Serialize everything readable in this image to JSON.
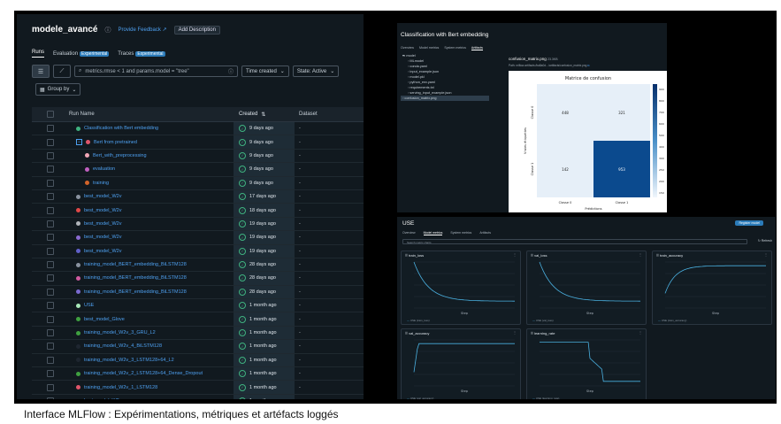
{
  "runs_page": {
    "experiment_title": "modele_avancé",
    "feedback_link": "Provide Feedback",
    "add_description": "Add Description",
    "tabs": [
      {
        "label": "Runs",
        "badge": ""
      },
      {
        "label": "Evaluation",
        "badge": "Experimental"
      },
      {
        "label": "Traces",
        "badge": "Experimental"
      }
    ],
    "search_value": "metrics.rmse < 1 and params.model = \"tree\"",
    "sort_dropdown": "Time created",
    "state_dropdown": "State: Active",
    "group_by": "Group by",
    "columns": {
      "name": "Run Name",
      "created": "Created",
      "dataset": "Dataset"
    },
    "rows": [
      {
        "name": "Classification with Bert embedding",
        "created": "9 days ago",
        "dataset": "-",
        "color": "#3fb27f",
        "level": 0,
        "parent": false
      },
      {
        "name": "Bert from pretrained",
        "created": "9 days ago",
        "dataset": "-",
        "color": "#e0566b",
        "level": 0,
        "parent": true
      },
      {
        "name": "Bert_with_preprocessing",
        "created": "9 days ago",
        "dataset": "-",
        "color": "#f0a6b6",
        "level": 1,
        "parent": false
      },
      {
        "name": "evaluation",
        "created": "9 days ago",
        "dataset": "-",
        "color": "#c060c0",
        "level": 1,
        "parent": false
      },
      {
        "name": "training",
        "created": "9 days ago",
        "dataset": "-",
        "color": "#d2642a",
        "level": 1,
        "parent": false
      },
      {
        "name": "best_model_W2v",
        "created": "17 days ago",
        "dataset": "-",
        "color": "#8a93a0",
        "level": 0,
        "parent": false
      },
      {
        "name": "best_model_W2v",
        "created": "18 days ago",
        "dataset": "-",
        "color": "#e04848",
        "level": 0,
        "parent": false
      },
      {
        "name": "best_model_W2v",
        "created": "19 days ago",
        "dataset": "-",
        "color": "#b0b4ba",
        "level": 0,
        "parent": false
      },
      {
        "name": "best_model_W2v",
        "created": "19 days ago",
        "dataset": "-",
        "color": "#8a6ad0",
        "level": 0,
        "parent": false
      },
      {
        "name": "best_model_W2v",
        "created": "19 days ago",
        "dataset": "-",
        "color": "#6060c8",
        "level": 0,
        "parent": false
      },
      {
        "name": "training_model_BERT_embedding_BiLSTM128",
        "created": "28 days ago",
        "dataset": "-",
        "color": "#8a93a0",
        "level": 0,
        "parent": false
      },
      {
        "name": "training_model_BERT_embedding_BiLSTM128",
        "created": "28 days ago",
        "dataset": "-",
        "color": "#d05aa0",
        "level": 0,
        "parent": false
      },
      {
        "name": "training_model_BERT_embedding_BiLSTM128",
        "created": "28 days ago",
        "dataset": "-",
        "color": "#7a6ad0",
        "level": 0,
        "parent": false
      },
      {
        "name": "USE",
        "created": "1 month ago",
        "dataset": "-",
        "color": "#a8e8b8",
        "level": 0,
        "parent": false
      },
      {
        "name": "best_model_Glove",
        "created": "1 month ago",
        "dataset": "-",
        "color": "#3fa040",
        "level": 0,
        "parent": false
      },
      {
        "name": "training_model_W2v_3_GRU_L2",
        "created": "1 month ago",
        "dataset": "-",
        "color": "#3fa040",
        "level": 0,
        "parent": false
      },
      {
        "name": "training_model_W2v_4_BiLSTM128",
        "created": "1 month ago",
        "dataset": "-",
        "color": "#1e2630",
        "level": 0,
        "parent": false
      },
      {
        "name": "training_model_W2v_3_LSTM128+64_L2",
        "created": "1 month ago",
        "dataset": "-",
        "color": "#1e2630",
        "level": 0,
        "parent": false
      },
      {
        "name": "training_model_W2v_2_LSTM128+64_Dense_Dropout",
        "created": "1 month ago",
        "dataset": "-",
        "color": "#3fa040",
        "level": 0,
        "parent": false
      },
      {
        "name": "training_model_W2v_1_LSTM128",
        "created": "1 month ago",
        "dataset": "-",
        "color": "#e0566b",
        "level": 0,
        "parent": false
      },
      {
        "name": "best_model_W2v",
        "created": "1 month ago",
        "dataset": "-",
        "color": "#3fa040",
        "level": 0,
        "parent": false
      }
    ]
  },
  "artifacts_page": {
    "run_title": "Classification with Bert embedding",
    "tabs": [
      "Overview",
      "Model metrics",
      "System metrics",
      "Artifacts"
    ],
    "active_tab": "Artifacts",
    "tree": [
      "model",
      "MLmodel",
      "conda.yaml",
      "input_example.json",
      "model.pkl",
      "python_env.yaml",
      "requirements.txt",
      "serving_input_example.json",
      "confusion_matrix.png"
    ],
    "selected_file": "confusion_matrix.png",
    "file_name": "confusion_matrix.png",
    "file_size": "23.3KB",
    "file_path": "Path: mlflow-artifacts:/ba8a0d…/artifacts/confusion_matrix.png",
    "confusion_matrix": {
      "title": "Matrice de confusion",
      "xlabel": "Prédictions",
      "ylabel": "Vraies étiquettes",
      "x_ticks": [
        "Classe 0",
        "Classe 1"
      ],
      "y_ticks": [
        "Classe 0",
        "Classe 1"
      ],
      "cells": [
        [
          448,
          321
        ],
        [
          142,
          953
        ]
      ],
      "colorbar_ticks": [
        "900",
        "800",
        "700",
        "600",
        "500",
        "400",
        "300",
        "250",
        "200",
        "150"
      ],
      "colors": {
        "dark": "#0b4a8e",
        "light": "#e6eff8"
      }
    }
  },
  "metrics_page": {
    "run_title": "USE",
    "register_button": "Register model",
    "tabs": [
      "Overview",
      "Model metrics",
      "System metrics",
      "Artifacts"
    ],
    "active_tab": "Model metrics",
    "filter_placeholder": "Search metric charts",
    "refresh": "Refresh",
    "charts": [
      {
        "title": "train_loss",
        "xlabel": "Step",
        "legend": "USE (train_loss)",
        "shape": "decay"
      },
      {
        "title": "val_loss",
        "xlabel": "Step",
        "legend": "USE (val_loss)",
        "shape": "decay"
      },
      {
        "title": "train_accuracy",
        "xlabel": "Step",
        "legend": "USE (train_accuracy)",
        "shape": "rise"
      },
      {
        "title": "val_accuracy",
        "xlabel": "Step",
        "legend": "USE (val_accuracy)",
        "shape": "plateau"
      },
      {
        "title": "learning_rate",
        "xlabel": "Step",
        "legend": "USE (learning_rate)",
        "shape": "step"
      }
    ]
  },
  "caption": "Interface MLFlow : Expérimentations, métriques et artéfacts loggés"
}
